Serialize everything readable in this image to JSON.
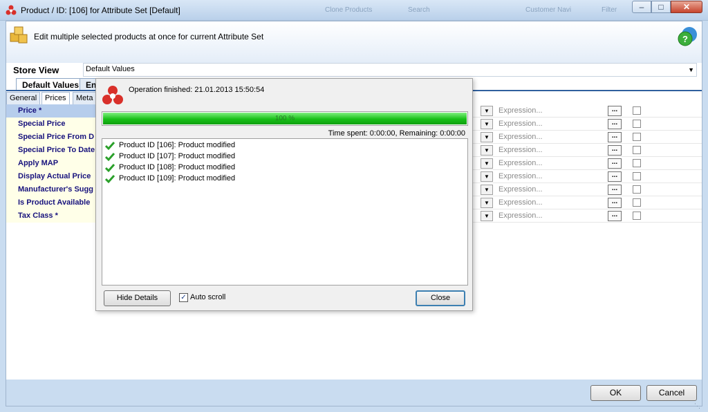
{
  "window": {
    "title": "Product / ID: [106] for Attribute Set [Default]",
    "header_text": "Edit multiple selected products at once for current Attribute Set",
    "ghost_items": [
      "Clone Products",
      "Search",
      "Customer Navi",
      "Filter"
    ]
  },
  "store_view": {
    "label": "Store View",
    "value": "Default Values"
  },
  "tabs_level1": [
    "Default Values",
    "Eng"
  ],
  "tabs_level2": [
    "General",
    "Prices",
    "Meta I"
  ],
  "attributes": [
    {
      "label": "Price *",
      "expression": "Expression..."
    },
    {
      "label": "Special Price",
      "expression": "Expression..."
    },
    {
      "label": "Special Price From D",
      "expression": "Expression..."
    },
    {
      "label": "Special Price To Date",
      "expression": "Expression..."
    },
    {
      "label": "Apply MAP",
      "expression": "Expression..."
    },
    {
      "label": "Display Actual Price",
      "expression": "Expression..."
    },
    {
      "label": "Manufacturer's Sugg",
      "expression": "Expression..."
    },
    {
      "label": "Is Product Available",
      "expression": "Expression..."
    },
    {
      "label": "Tax Class *",
      "expression": "Expression..."
    }
  ],
  "dialog": {
    "status": "Operation finished: 21.01.2013 15:50:54",
    "progress_text": "100 %",
    "progress_value": 100,
    "time_info": "Time spent: 0:00:00,  Remaining: 0:00:00",
    "log": [
      "Product ID [106]: Product modified",
      "Product ID [107]: Product modified",
      "Product ID [108]: Product modified",
      "Product ID [109]: Product modified"
    ],
    "hide_details_label": "Hide Details",
    "auto_scroll_label": "Auto scroll",
    "auto_scroll_checked": true,
    "close_label": "Close"
  },
  "footer": {
    "ok_label": "OK",
    "cancel_label": "Cancel"
  },
  "colors": {
    "accent": "#2f5f9e",
    "attribute_text": "#17127d",
    "progress_green": "#18c018"
  }
}
